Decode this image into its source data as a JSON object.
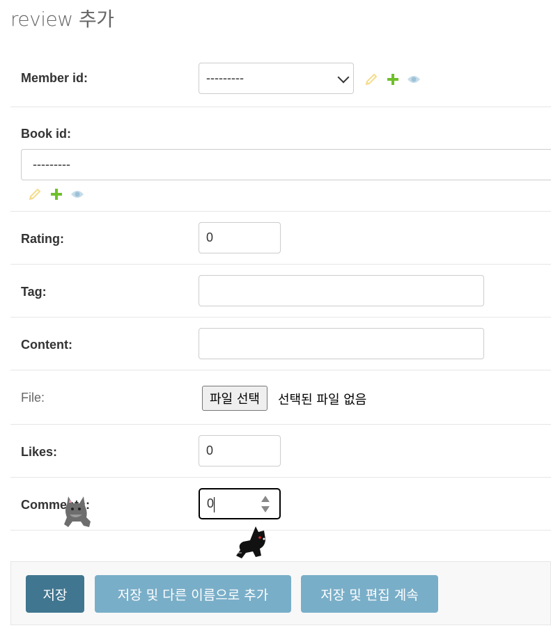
{
  "page": {
    "title": "review 추가"
  },
  "fields": {
    "member_id": {
      "label": "Member id:",
      "value": "---------"
    },
    "book_id": {
      "label": "Book id:",
      "value": "---------"
    },
    "rating": {
      "label": "Rating:",
      "value": "0"
    },
    "tag": {
      "label": "Tag:",
      "value": ""
    },
    "content": {
      "label": "Content:",
      "value": ""
    },
    "file": {
      "label": "File:",
      "button_label": "파일 선택",
      "status": "선택된 파일 없음"
    },
    "likes": {
      "label": "Likes:",
      "value": "0"
    },
    "comments": {
      "label": "Comments:",
      "value": "0"
    }
  },
  "buttons": {
    "save": "저장",
    "save_as_new": "저장 및 다른 이름으로 추가",
    "save_continue": "저장 및 편집 계속"
  },
  "colors": {
    "primary_button": "#417690",
    "secondary_button": "#79aec8",
    "edit_icon": "#efb80b",
    "add_icon": "#70bf2b",
    "view_icon": "#447e9b"
  }
}
